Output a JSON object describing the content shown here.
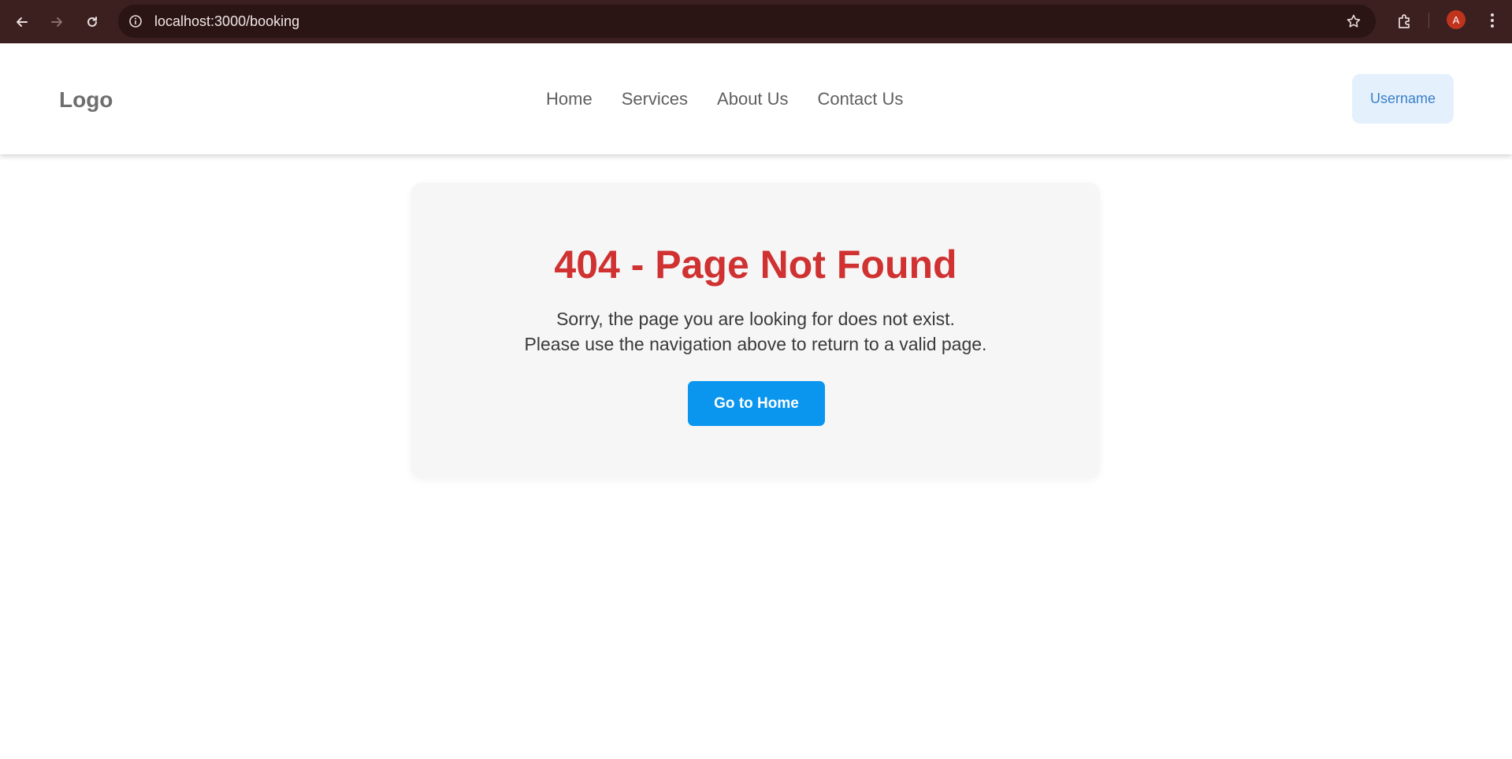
{
  "browser": {
    "url": "localhost:3000/booking",
    "profile_initial": "A"
  },
  "header": {
    "logo": "Logo",
    "nav": [
      {
        "label": "Home"
      },
      {
        "label": "Services"
      },
      {
        "label": "About Us"
      },
      {
        "label": "Contact Us"
      }
    ],
    "user_button": "Username"
  },
  "error": {
    "title": "404 - Page Not Found",
    "message_line1": "Sorry, the page you are looking for does not exist.",
    "message_line2": "Please use the navigation above to return to a valid page.",
    "home_button": "Go to Home"
  },
  "colors": {
    "browser_bar": "#3c1f1f",
    "title_red": "#d03131",
    "primary_button": "#0a95ef",
    "user_button_bg": "#e4f1fd"
  }
}
